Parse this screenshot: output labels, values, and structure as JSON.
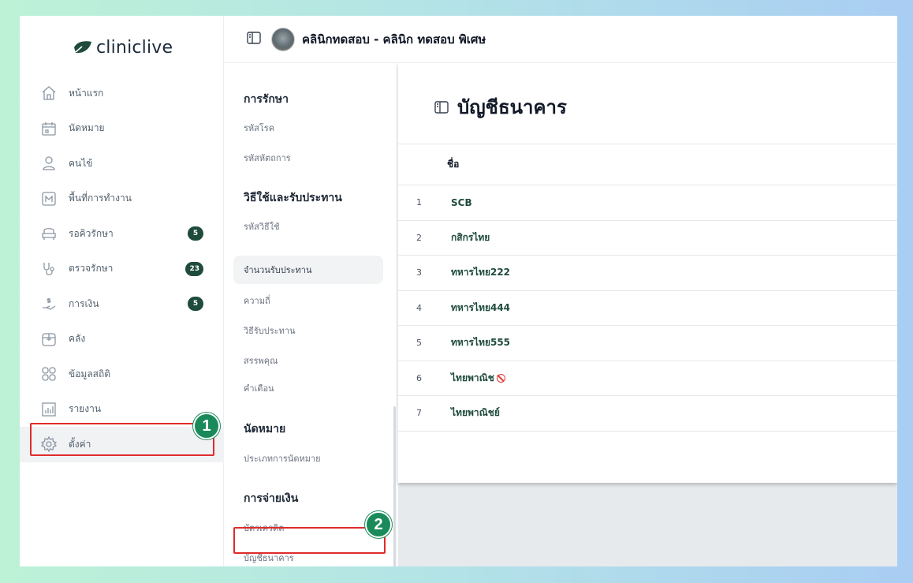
{
  "brand": {
    "logo_light": "clinic",
    "logo_bold": "live"
  },
  "header": {
    "clinic_name": "คลินิกทดสอบ - คลินิก ทดสอบ พิเศษ"
  },
  "sidebar": {
    "items": [
      {
        "label": "หน้าแรก",
        "icon": "home-icon"
      },
      {
        "label": "นัดหมาย",
        "icon": "calendar-icon"
      },
      {
        "label": "คนไข้",
        "icon": "user-icon"
      },
      {
        "label": "พื้นที่การทำงาน",
        "icon": "workspace-icon"
      },
      {
        "label": "รอคิวรักษา",
        "icon": "sofa-icon",
        "badge": "5"
      },
      {
        "label": "ตรวจรักษา",
        "icon": "stethoscope-icon",
        "badge": "23"
      },
      {
        "label": "การเงิน",
        "icon": "money-hand-icon",
        "badge": "5"
      },
      {
        "label": "คลัง",
        "icon": "box-icon"
      },
      {
        "label": "ข้อมูลสถิติ",
        "icon": "grid-icon"
      },
      {
        "label": "รายงาน",
        "icon": "report-icon"
      },
      {
        "label": "ตั้งค่า",
        "icon": "gear-icon"
      }
    ]
  },
  "steps": {
    "one": "1",
    "two": "2"
  },
  "submenu": {
    "g1": "การรักษา",
    "g1_items": [
      "รหัสโรค",
      "รหัสหัตถการ"
    ],
    "g2": "วิธีใช้และรับประทาน",
    "g2_items": [
      "รหัสวิธีใช้",
      "จำนวนรับประทาน",
      "ความถี่",
      "วิธีรับประทาน",
      "สรรพคุณ",
      "คำเตือน"
    ],
    "g3": "นัดหมาย",
    "g3_items": [
      "ประเภทการนัดหมาย"
    ],
    "g4": "การจ่ายเงิน",
    "g4_items": [
      "บัตรเครดิต",
      "บัญชีธนาคาร"
    ]
  },
  "main": {
    "title": "บัญชีธนาคาร",
    "column_name": "ชื่อ",
    "rows": [
      {
        "idx": "1",
        "name": "SCB"
      },
      {
        "idx": "2",
        "name": "กสิกรไทย"
      },
      {
        "idx": "3",
        "name": "ทหารไทย222"
      },
      {
        "idx": "4",
        "name": "ทหารไทย444"
      },
      {
        "idx": "5",
        "name": "ทหารไทย555"
      },
      {
        "idx": "6",
        "name": "ไทยพาณิช"
      },
      {
        "idx": "7",
        "name": "ไทยพาณิชย์"
      }
    ]
  },
  "colors": {
    "accent": "#1f4b3b",
    "highlight": "#e02b2b",
    "step": "#1a8a5a"
  }
}
